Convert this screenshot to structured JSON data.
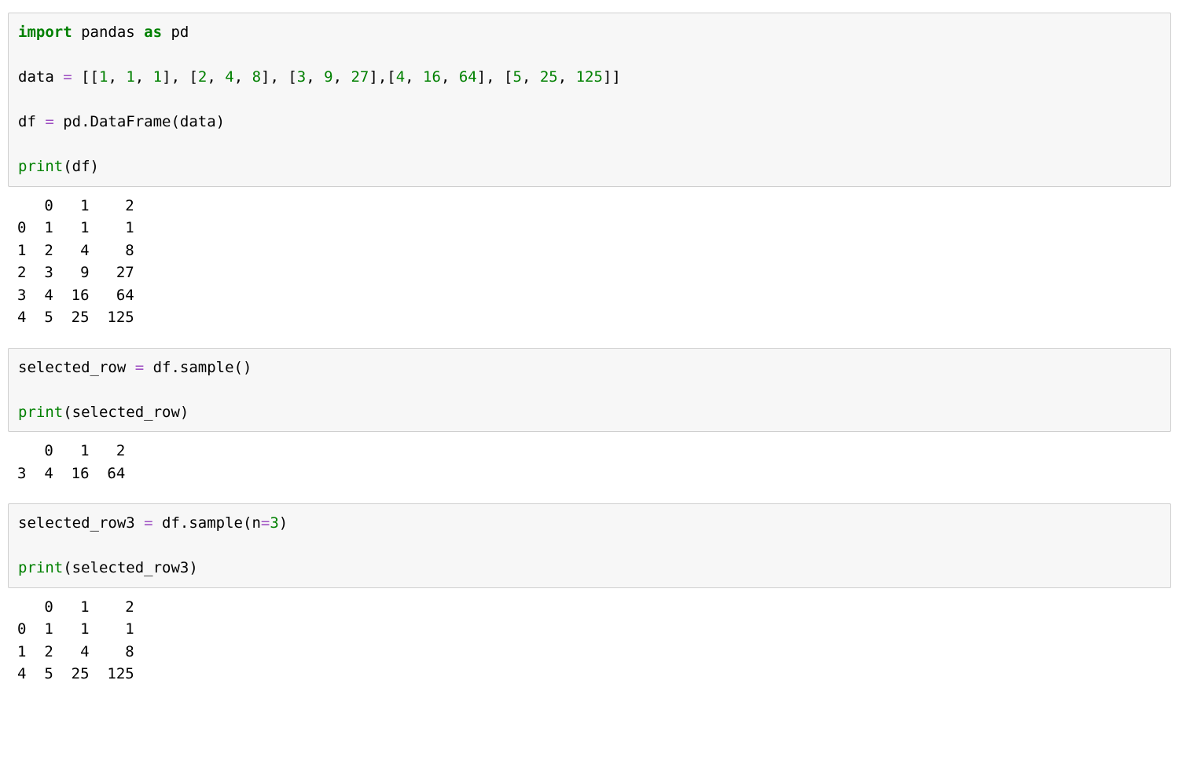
{
  "cell1": {
    "code": {
      "kw_import": "import",
      "pandas": " pandas ",
      "kw_as": "as",
      "pd": " pd",
      "line2_a": "data ",
      "eq": "=",
      "line2_b": " [[",
      "n1": "1",
      "c": ", ",
      "n1b": "1",
      "n1c": "1",
      "br_close_open": "], [",
      "n2": "2",
      "n4": "4",
      "n8": "8",
      "n3": "3",
      "n9": "9",
      "n27": "27",
      "br_close_open2": "],[",
      "n4b": "4",
      "n16": "16",
      "n64": "64",
      "n5": "5",
      "n25": "25",
      "n125": "125",
      "br_end": "]]",
      "line3_a": "df ",
      "line3_b": " pd.DataFrame(data)",
      "print": "print",
      "print_arg": "(df)"
    },
    "output": "   0   1    2\n0  1   1    1\n1  2   4    8\n2  3   9   27\n3  4  16   64\n4  5  25  125"
  },
  "cell2": {
    "code": {
      "a": "selected_row ",
      "eq": "=",
      "b": " df.sample()",
      "print": "print",
      "print_arg": "(selected_row)"
    },
    "output": "   0   1   2\n3  4  16  64"
  },
  "cell3": {
    "code": {
      "a": "selected_row3 ",
      "eq": "=",
      "b": " df.sample(n",
      "eq2": "=",
      "n3": "3",
      "c": ")",
      "print": "print",
      "print_arg": "(selected_row3)"
    },
    "output": "   0   1    2\n0  1   1    1\n1  2   4    8\n4  5  25  125"
  }
}
